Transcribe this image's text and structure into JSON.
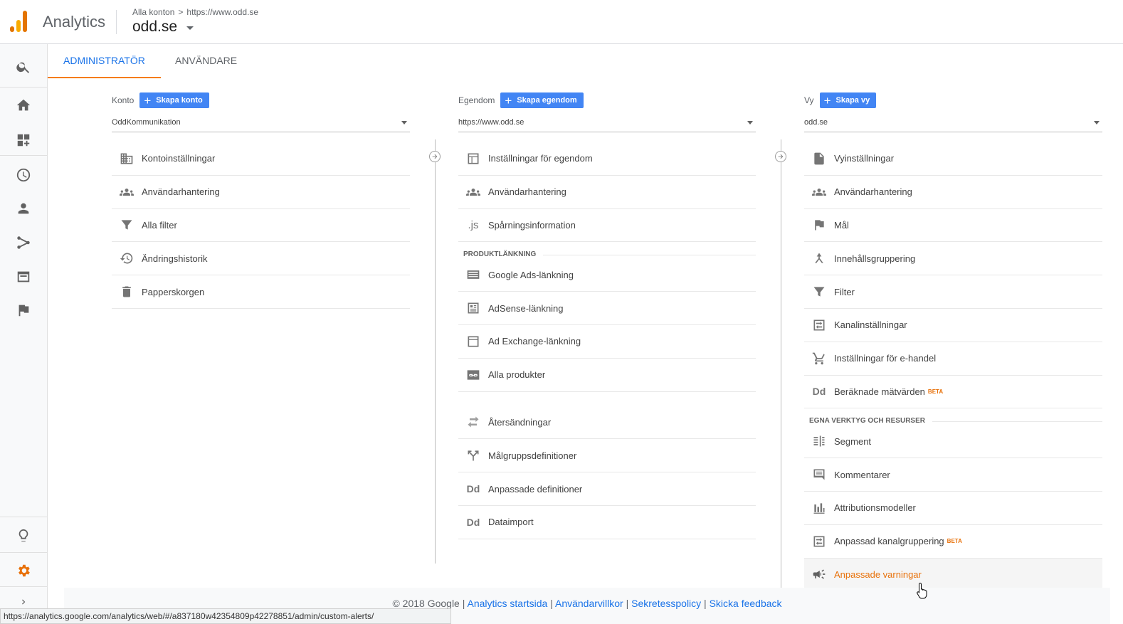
{
  "header": {
    "app_name": "Analytics",
    "breadcrumb_account": "Alla konton",
    "breadcrumb_sep": ">",
    "breadcrumb_property": "https://www.odd.se",
    "property_name": "odd.se"
  },
  "tabs": [
    {
      "label": "ADMINISTRATÖR",
      "active": true
    },
    {
      "label": "ANVÄNDARE",
      "active": false
    }
  ],
  "columns": {
    "account": {
      "title": "Konto",
      "create_label": "Skapa konto",
      "selected": "OddKommunikation",
      "items": [
        {
          "label": "Kontoinställningar",
          "icon": "building-icon"
        },
        {
          "label": "Användarhantering",
          "icon": "users-icon"
        },
        {
          "label": "Alla filter",
          "icon": "filter-icon"
        },
        {
          "label": "Ändringshistorik",
          "icon": "history-icon"
        },
        {
          "label": "Papperskorgen",
          "icon": "trash-icon"
        }
      ]
    },
    "property": {
      "title": "Egendom",
      "create_label": "Skapa egendom",
      "selected": "https://www.odd.se",
      "items": [
        {
          "label": "Inställningar för egendom",
          "icon": "window-icon"
        },
        {
          "label": "Användarhantering",
          "icon": "users-icon"
        },
        {
          "label": "Spårningsinformation",
          "icon": "js-icon",
          "glyph": ".js"
        }
      ],
      "section_label": "PRODUKTLÄNKNING",
      "linking_items": [
        {
          "label": "Google Ads-länkning",
          "icon": "ads-icon"
        },
        {
          "label": "AdSense-länkning",
          "icon": "adsense-icon"
        },
        {
          "label": "Ad Exchange-länkning",
          "icon": "window-icon"
        },
        {
          "label": "Alla produkter",
          "icon": "link-icon"
        }
      ],
      "other_items": [
        {
          "label": "Återsändningar",
          "icon": "postback-icon"
        },
        {
          "label": "Målgruppsdefinitioner",
          "icon": "audience-icon"
        },
        {
          "label": "Anpassade definitioner",
          "icon": "dd-icon",
          "glyph": "Dd"
        },
        {
          "label": "Dataimport",
          "icon": "dd-icon",
          "glyph": "Dd"
        }
      ]
    },
    "view": {
      "title": "Vy",
      "create_label": "Skapa vy",
      "selected": "odd.se",
      "items": [
        {
          "label": "Vyinställningar",
          "icon": "document-icon"
        },
        {
          "label": "Användarhantering",
          "icon": "users-icon"
        },
        {
          "label": "Mål",
          "icon": "flag-icon"
        },
        {
          "label": "Innehållsgruppering",
          "icon": "content-group-icon"
        },
        {
          "label": "Filter",
          "icon": "filter-icon"
        },
        {
          "label": "Kanalinställningar",
          "icon": "channel-icon"
        },
        {
          "label": "Inställningar för e-handel",
          "icon": "cart-icon"
        },
        {
          "label": "Beräknade mätvärden",
          "icon": "dd-icon",
          "glyph": "Dd",
          "badge": "BETA"
        }
      ],
      "section_label": "EGNA VERKTYG OCH RESURSER",
      "tools_items": [
        {
          "label": "Segment",
          "icon": "segment-icon"
        },
        {
          "label": "Kommentarer",
          "icon": "comment-icon"
        },
        {
          "label": "Attributionsmodeller",
          "icon": "bar-chart-icon"
        },
        {
          "label": "Anpassad kanalgruppering",
          "icon": "channel-icon",
          "badge": "BETA"
        },
        {
          "label": "Anpassade varningar",
          "icon": "megaphone-icon",
          "hover": true
        }
      ]
    }
  },
  "footer": {
    "copyright": "© 2018 Google",
    "links": [
      "Analytics startsida",
      "Användarvillkor",
      "Sekretesspolicy",
      "Skicka feedback"
    ]
  },
  "statusbar": {
    "url": "https://analytics.google.com/analytics/web/#/a837180w42354809p42278851/admin/custom-alerts/"
  },
  "colors": {
    "accent": "#1a73e8",
    "tab_underline": "#f57c00",
    "create_button": "#4285f4",
    "hover_text": "#e8710a"
  }
}
